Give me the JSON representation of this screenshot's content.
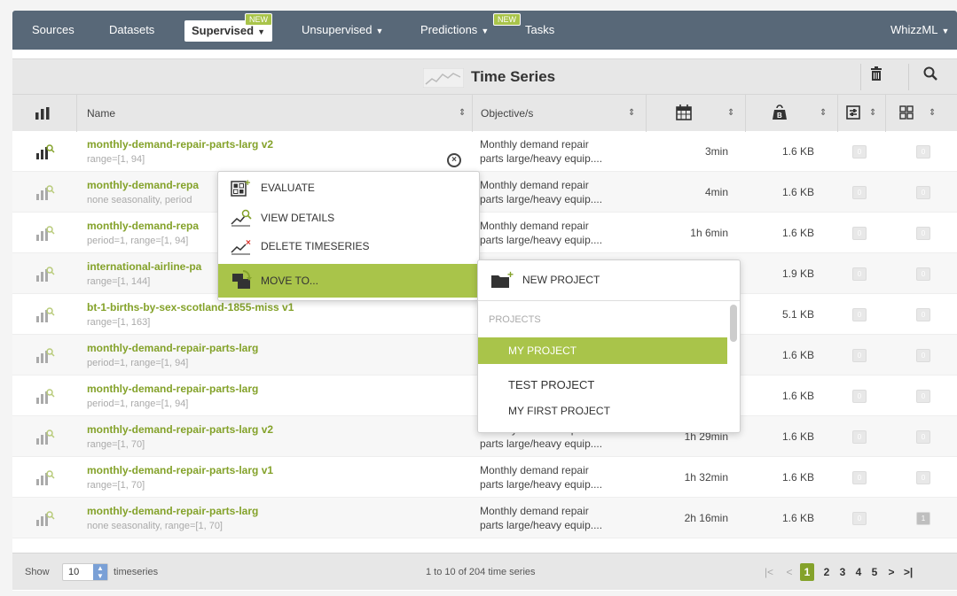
{
  "nav": {
    "sources": "Sources",
    "datasets": "Datasets",
    "supervised": "Supervised",
    "unsupervised": "Unsupervised",
    "predictions": "Predictions",
    "tasks": "Tasks",
    "whizzml": "WhizzML",
    "new_badge": "NEW"
  },
  "header": {
    "title": "Time Series",
    "delete_icon": "trash-icon",
    "search_icon": "search-icon"
  },
  "columns": {
    "name": "Name",
    "objective": "Objective/s",
    "created_icon": "calendar-icon",
    "size_icon": "weight-icon",
    "model_icon": "settings-icon",
    "eval_icon": "grid-icon"
  },
  "rows": [
    {
      "name": "monthly-demand-repair-parts-larg v2",
      "sub": "range=[1, 94]",
      "obj1": "Monthly demand repair",
      "obj2": "parts large/heavy equip....",
      "time": "3min",
      "size": "1.6 KB",
      "c1": "0",
      "c2": "0"
    },
    {
      "name": "monthly-demand-repa",
      "sub": "none seasonality, period",
      "obj1": "Monthly demand repair",
      "obj2": "parts large/heavy equip....",
      "time": "4min",
      "size": "1.6 KB",
      "c1": "0",
      "c2": "0"
    },
    {
      "name": "monthly-demand-repa",
      "sub": "period=1, range=[1, 94]",
      "obj1": "Monthly demand repair",
      "obj2": "parts large/heavy equip....",
      "time": "1h 6min",
      "size": "1.6 KB",
      "c1": "0",
      "c2": "0"
    },
    {
      "name": "international-airline-pa",
      "sub": "range=[1, 144]",
      "obj1": "",
      "obj2": "",
      "time": "",
      "size": "1.9 KB",
      "c1": "0",
      "c2": "0"
    },
    {
      "name": "bt-1-births-by-sex-scotland-1855-miss v1",
      "sub": "range=[1, 163]",
      "obj1": "",
      "obj2": "",
      "time": "",
      "size": "5.1 KB",
      "c1": "0",
      "c2": "0"
    },
    {
      "name": "monthly-demand-repair-parts-larg",
      "sub": "period=1, range=[1, 94]",
      "obj1": "",
      "obj2": "",
      "time": "",
      "size": "1.6 KB",
      "c1": "0",
      "c2": "0"
    },
    {
      "name": "monthly-demand-repair-parts-larg",
      "sub": "period=1, range=[1, 94]",
      "obj1": "",
      "obj2": "",
      "time": "",
      "size": "1.6 KB",
      "c1": "0",
      "c2": "0"
    },
    {
      "name": "monthly-demand-repair-parts-larg v2",
      "sub": "range=[1, 70]",
      "obj1": "Monthly demand repair",
      "obj2": "parts large/heavy equip....",
      "time": "1h 29min",
      "size": "1.6 KB",
      "c1": "0",
      "c2": "0"
    },
    {
      "name": "monthly-demand-repair-parts-larg v1",
      "sub": "range=[1, 70]",
      "obj1": "Monthly demand repair",
      "obj2": "parts large/heavy equip....",
      "time": "1h 32min",
      "size": "1.6 KB",
      "c1": "0",
      "c2": "0"
    },
    {
      "name": "monthly-demand-repair-parts-larg",
      "sub": "none seasonality, range=[1, 70]",
      "obj1": "Monthly demand repair",
      "obj2": "parts large/heavy equip....",
      "time": "2h 16min",
      "size": "1.6 KB",
      "c1": "0",
      "c2": "1"
    }
  ],
  "context_menu": {
    "evaluate": "EVALUATE",
    "view_details": "VIEW DETAILS",
    "delete": "DELETE TIMESERIES",
    "move_to": "MOVE TO..."
  },
  "submenu": {
    "new_project": "NEW PROJECT",
    "section": "PROJECTS",
    "projects": [
      "MY PROJECT",
      "TEST PROJECT",
      "MY FIRST PROJECT"
    ]
  },
  "footer": {
    "show": "Show",
    "per_page": "10",
    "unit": "timeseries",
    "summary": "1 to 10 of 204 time series",
    "pages": [
      "1",
      "2",
      "3",
      "4",
      "5"
    ],
    "first": "|<",
    "prev": "<",
    "next": ">",
    "last": ">|"
  },
  "colors": {
    "nav_bg": "#586878",
    "accent_green": "#84a22a",
    "highlight_green": "#a9c44a"
  }
}
